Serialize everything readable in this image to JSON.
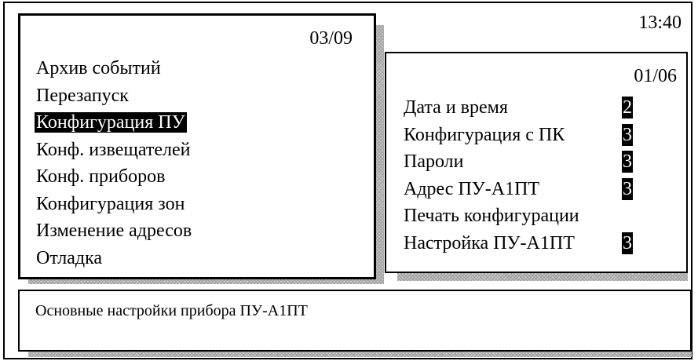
{
  "clock": "13:40",
  "main_menu": {
    "page_indicator": "03/09",
    "selected_index": 2,
    "items": [
      "Архив событий",
      "Перезапуск",
      "Конфигурация ПУ",
      "Конф. извещателей",
      "Конф. приборов",
      "Конфигурация зон",
      "Изменение адресов",
      "Отладка"
    ]
  },
  "submenu": {
    "page_indicator": "01/06",
    "items": [
      {
        "label": "Дата и время",
        "level": "2"
      },
      {
        "label": "Конфигурация с ПК",
        "level": "3"
      },
      {
        "label": "Пароли",
        "level": "3"
      },
      {
        "label": "Адрес ПУ-А1ПТ",
        "level": "3"
      },
      {
        "label": "Печать конфигурации",
        "level": ""
      },
      {
        "label": "Настройка ПУ-А1ПТ",
        "level": "3"
      }
    ]
  },
  "status_bar": {
    "text": "Основные настройки прибора ПУ-А1ПТ"
  }
}
